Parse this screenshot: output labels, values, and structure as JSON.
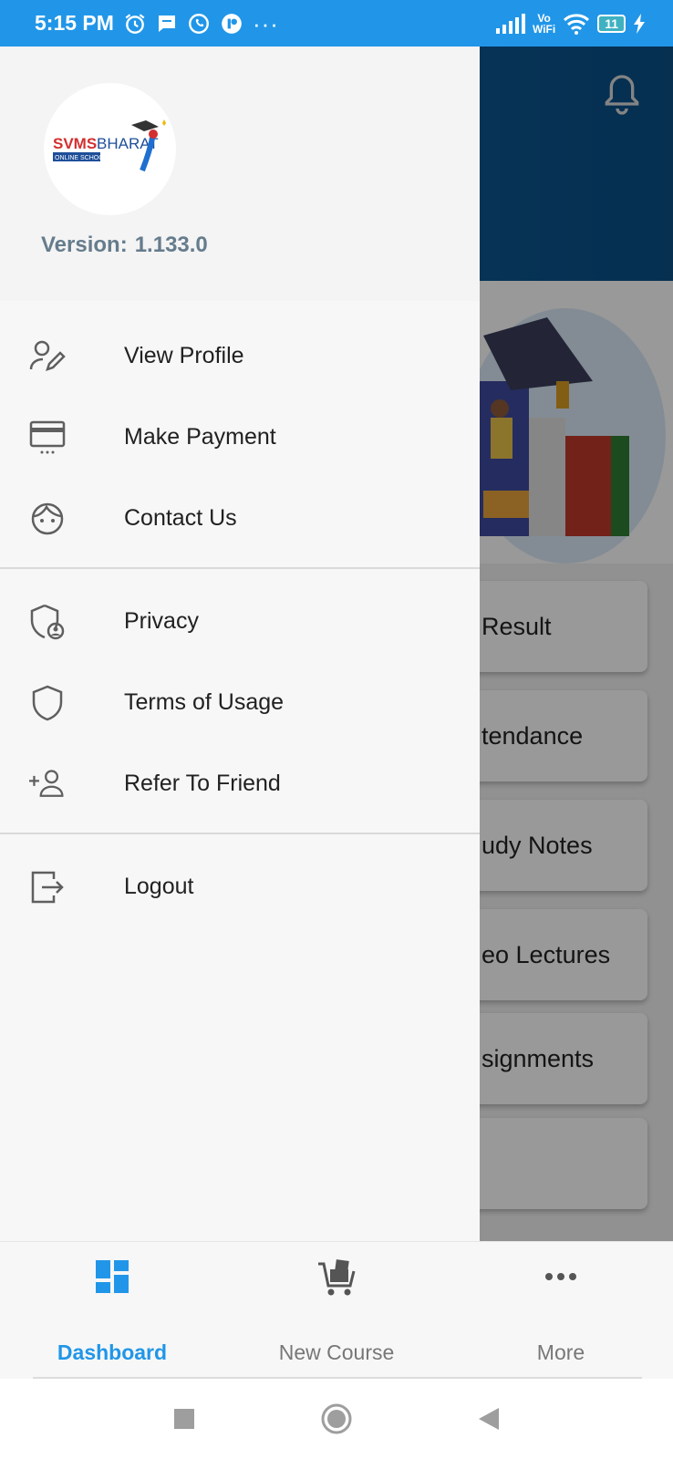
{
  "status_bar": {
    "time": "5:15 PM",
    "battery": "11",
    "vowifi_top": "Vo",
    "vowifi_bottom": "WiFi",
    "more": "···"
  },
  "background": {
    "cards": [
      "Result",
      "tendance",
      "udy Notes",
      "eo Lectures",
      "signments",
      ""
    ]
  },
  "drawer": {
    "logo": {
      "brand": "SVMSBHARAT",
      "sub": "ONLINE SCHOOL"
    },
    "version_label": "Version:",
    "version_value": "1.133.0",
    "menu": [
      {
        "label": "View Profile",
        "icon": "edit-user-icon"
      },
      {
        "label": "Make Payment",
        "icon": "credit-card-icon"
      },
      {
        "label": "Contact Us",
        "icon": "support-agent-icon"
      },
      {
        "label": "Privacy",
        "icon": "privacy-shield-icon"
      },
      {
        "label": "Terms of Usage",
        "icon": "shield-icon"
      },
      {
        "label": "Refer To Friend",
        "icon": "add-user-icon"
      },
      {
        "label": "Logout",
        "icon": "logout-icon"
      }
    ]
  },
  "bottom_nav": {
    "items": [
      {
        "label": "Dashboard",
        "icon": "dashboard-icon",
        "active": true
      },
      {
        "label": "New Course",
        "icon": "cart-icon",
        "active": false
      },
      {
        "label": "More",
        "icon": "more-dots-icon",
        "active": false
      }
    ]
  },
  "colors": {
    "accent": "#2196e8",
    "header_dark": "#0b4f86",
    "version_text": "#657c8c"
  }
}
